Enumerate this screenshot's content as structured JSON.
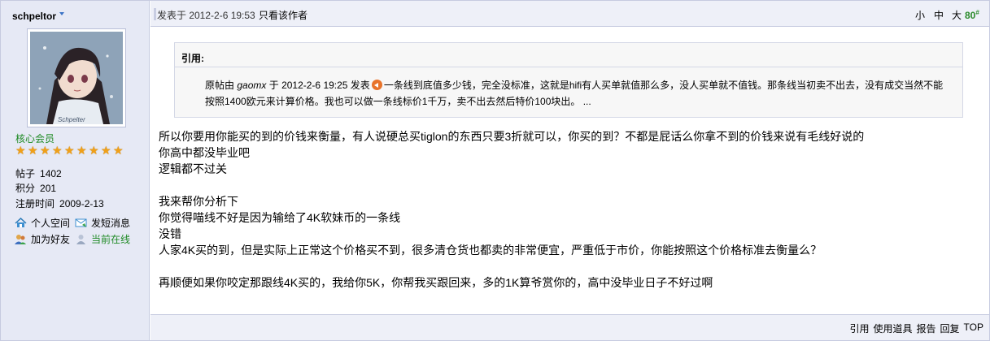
{
  "user": {
    "name": "schpeltor",
    "avatar_caption": "Schpelter",
    "rank": "核心会员",
    "stars": 9,
    "stats": [
      {
        "key": "帖子",
        "value": "1402"
      },
      {
        "key": "积分",
        "value": "201"
      },
      {
        "key": "注册时间",
        "value": "2009-2-13"
      }
    ],
    "actions": {
      "profile": "个人空间",
      "message": "发短消息",
      "add_friend": "加为好友",
      "online": "当前在线"
    }
  },
  "header": {
    "posted": "发表于 2012-2-6 19:53",
    "only_author": "只看该作者",
    "font_small": "小",
    "font_medium": "中",
    "font_large": "大",
    "floor": "80",
    "floor_sup": "#"
  },
  "quote": {
    "label": "引用:",
    "prefix": "原帖由",
    "author": "gaomx",
    "mid": "于 2012-2-6 19:25 发表",
    "text_line1": "一条线到底值多少钱，完全没标准，这就是hifi有人买单就值那么多，没人买单就不值钱。那条线当初卖不出去，没有成交当然不能",
    "text_line2": "按照1400欧元来计算价格。我也可以做一条线标价1千万，卖不出去然后特价100块出。 ..."
  },
  "message": {
    "lines": [
      "所以你要用你能买的到的价钱来衡量，有人说硬总买tiglon的东西只要3折就可以，你买的到？不都是屁话么你拿不到的价钱来说有毛线好说的",
      "你高中都没毕业吧",
      "逻辑都不过关",
      "",
      "我来帮你分析下",
      "你觉得喵线不好是因为输给了4K软妹币的一条线",
      "没错",
      "人家4K买的到，但是实际上正常这个价格买不到，很多清仓货也都卖的非常便宜，严重低于市价，你能按照这个价格标准去衡量么？",
      "",
      "再顺便如果你咬定那跟线4K买的，我给你5K，你帮我买跟回来，多的1K算爷赏你的，高中没毕业日子不好过啊"
    ]
  },
  "footer": {
    "quote": "引用",
    "tools": "使用道具",
    "report": "报告",
    "reply": "回复",
    "top": "TOP"
  },
  "colors": {
    "sidebar_bg": "#e6e9f5",
    "header_bg": "#eef0f8",
    "border": "#c6cbe0",
    "rank_green": "#1f8a25",
    "star_orange": "#f0a018"
  }
}
